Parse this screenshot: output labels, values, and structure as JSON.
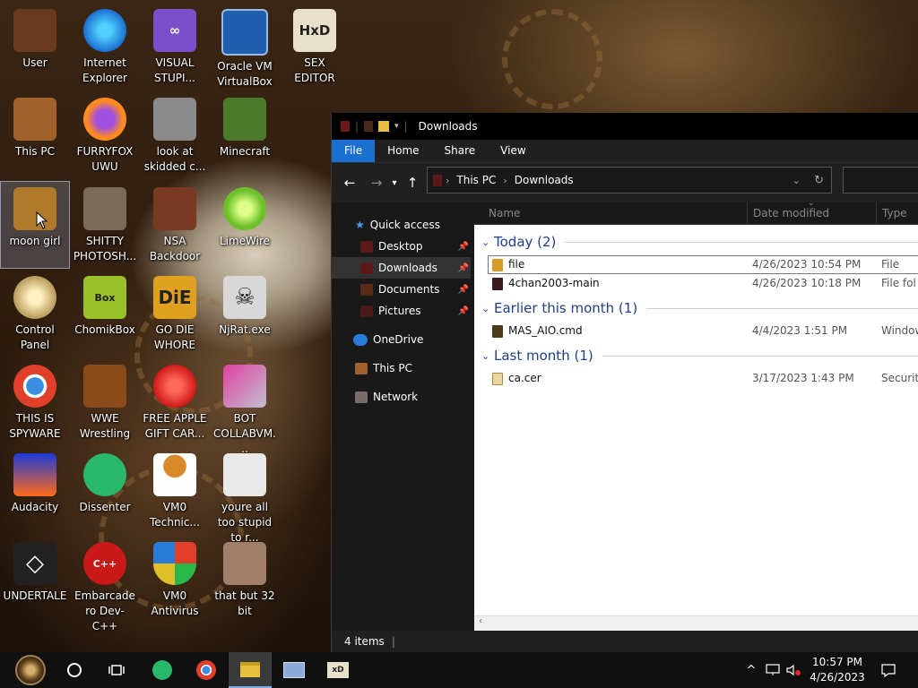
{
  "desktop": {
    "icons": [
      {
        "label": "User",
        "glyph": "user-icon",
        "color": "#6b3a1e"
      },
      {
        "label": "Internet Explorer",
        "glyph": "edge-icon",
        "color": "#1b8fe0"
      },
      {
        "label": "VISUAL STUPI...",
        "glyph": "visual-studio-icon",
        "color": "#7b4fc9"
      },
      {
        "label": "Oracle VM VirtualBox",
        "glyph": "virtualbox-icon",
        "color": "#1f5fae"
      },
      {
        "label": "SEX EDITOR",
        "glyph": "hxd-icon",
        "color": "#d9d2b8"
      },
      {
        "label": "This PC",
        "glyph": "this-pc-icon",
        "color": "#a0622a"
      },
      {
        "label": "FURRYFOX UWU",
        "glyph": "firefox-icon",
        "color": "#e8571e"
      },
      {
        "label": "look at skidded c...",
        "glyph": "copy-icon",
        "color": "#8a8a8a"
      },
      {
        "label": "Minecraft",
        "glyph": "minecraft-icon",
        "color": "#4a7a2a"
      },
      {
        "label": "moon girl",
        "glyph": "folder-icon",
        "color": "#b07a2a"
      },
      {
        "label": "SHITTY PHOTOSH...",
        "glyph": "gimp-icon",
        "color": "#7a6a5a"
      },
      {
        "label": "NSA Backdoor",
        "glyph": "nsa-icon",
        "color": "#7a3a22"
      },
      {
        "label": "LimeWire",
        "glyph": "limewire-icon",
        "color": "#6cc02a"
      },
      {
        "label": "Control Panel",
        "glyph": "lightbulb-icon",
        "color": "#b89a5a"
      },
      {
        "label": "ChomikBox",
        "glyph": "chomikbox-icon",
        "color": "#9ac02a"
      },
      {
        "label": "GO DIE WHORE",
        "glyph": "die-icon",
        "color": "#e0a020"
      },
      {
        "label": "NjRat.exe",
        "glyph": "skull-icon",
        "color": "#d8d8d8"
      },
      {
        "label": "THIS IS SPYWARE",
        "glyph": "chrome-icon",
        "color": "#3a8ee0"
      },
      {
        "label": "WWE Wrestling",
        "glyph": "wwe-icon",
        "color": "#8a4a1a"
      },
      {
        "label": "FREE APPLE GIFT CAR...",
        "glyph": "apple-icon",
        "color": "#d01818"
      },
      {
        "label": "BOT COLLABVM...",
        "glyph": "monitor-icon",
        "color": "#c0c0d0"
      },
      {
        "label": "Audacity",
        "glyph": "audacity-icon",
        "color": "#1a3ad8"
      },
      {
        "label": "Dissenter",
        "glyph": "dissenter-icon",
        "color": "#2ab86a"
      },
      {
        "label": "VM0 Technic...",
        "glyph": "technician-icon",
        "color": "#d88a2a"
      },
      {
        "label": "youre all too stupid to r...",
        "glyph": "face-icon",
        "color": "#e8e8e8"
      },
      {
        "label": "UNDERTALE",
        "glyph": "unity-icon",
        "color": "#222222"
      },
      {
        "label": "Embarcadero Dev-C++",
        "glyph": "devcpp-icon",
        "color": "#c81818"
      },
      {
        "label": "VM0 Antivirus",
        "glyph": "shield-icon",
        "color": "#2a7ad8"
      },
      {
        "label": "that but 32 bit",
        "glyph": "portrait-icon",
        "color": "#a0806a"
      }
    ]
  },
  "explorer": {
    "title": "Downloads",
    "tabs": [
      "File",
      "Home",
      "Share",
      "View"
    ],
    "address": {
      "crumbs": [
        "This PC",
        "Downloads"
      ]
    },
    "nav": {
      "quick_access": "Quick access",
      "items": [
        "Desktop",
        "Downloads",
        "Documents",
        "Pictures"
      ],
      "onedrive": "OneDrive",
      "thispc": "This PC",
      "network": "Network"
    },
    "columns": {
      "name": "Name",
      "date": "Date modified",
      "type": "Type"
    },
    "groups": [
      {
        "label": "Today (2)",
        "files": [
          {
            "name": "file",
            "date": "4/26/2023 10:54 PM",
            "type": "File"
          },
          {
            "name": "4chan2003-main",
            "date": "4/26/2023 10:18 PM",
            "type": "File fol"
          }
        ]
      },
      {
        "label": "Earlier this month (1)",
        "files": [
          {
            "name": "MAS_AIO.cmd",
            "date": "4/4/2023 1:51 PM",
            "type": "Window"
          }
        ]
      },
      {
        "label": "Last month (1)",
        "files": [
          {
            "name": "ca.cer",
            "date": "3/17/2023 1:43 PM",
            "type": "Securit"
          }
        ]
      }
    ],
    "status": "4 items"
  },
  "taskbar": {
    "time": "10:57 PM",
    "date": "4/26/2023"
  }
}
